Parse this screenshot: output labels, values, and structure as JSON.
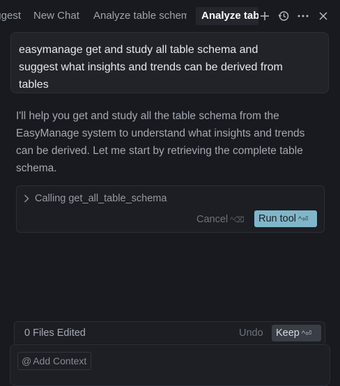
{
  "tabs": [
    {
      "label": "Suggest"
    },
    {
      "label": "New Chat"
    },
    {
      "label": "Analyze table schema"
    },
    {
      "label": "Analyze table"
    }
  ],
  "tab_icons": [
    "plus-icon",
    "history-icon",
    "more-icon",
    "close-icon"
  ],
  "user_message": {
    "line1": "easymanage get and study all table schema and",
    "line2": "suggest what insights and trends can be derived from",
    "line3": "tables"
  },
  "assistant_message": {
    "line1": "I'll help you get and study all the table schema from the",
    "line2": "EasyManage system to understand what insights and trends",
    "line3": "can be derived. Let me start by retrieving the complete table",
    "line4": "schema."
  },
  "tool_call": {
    "label": "Calling get_all_table_schema",
    "cancel_label": "Cancel",
    "cancel_shortcut": "^⌫",
    "run_label": "Run tool",
    "run_shortcut": "^⏎"
  },
  "files_bar": {
    "label": "0 Files Edited",
    "undo_label": "Undo",
    "keep_label": "Keep",
    "keep_shortcut": "^⏎"
  },
  "composer": {
    "context_label": "Add Context"
  },
  "colors": {
    "background": "#181a1f",
    "run_button": "#80b6c9",
    "keep_button": "#3a3e46"
  }
}
